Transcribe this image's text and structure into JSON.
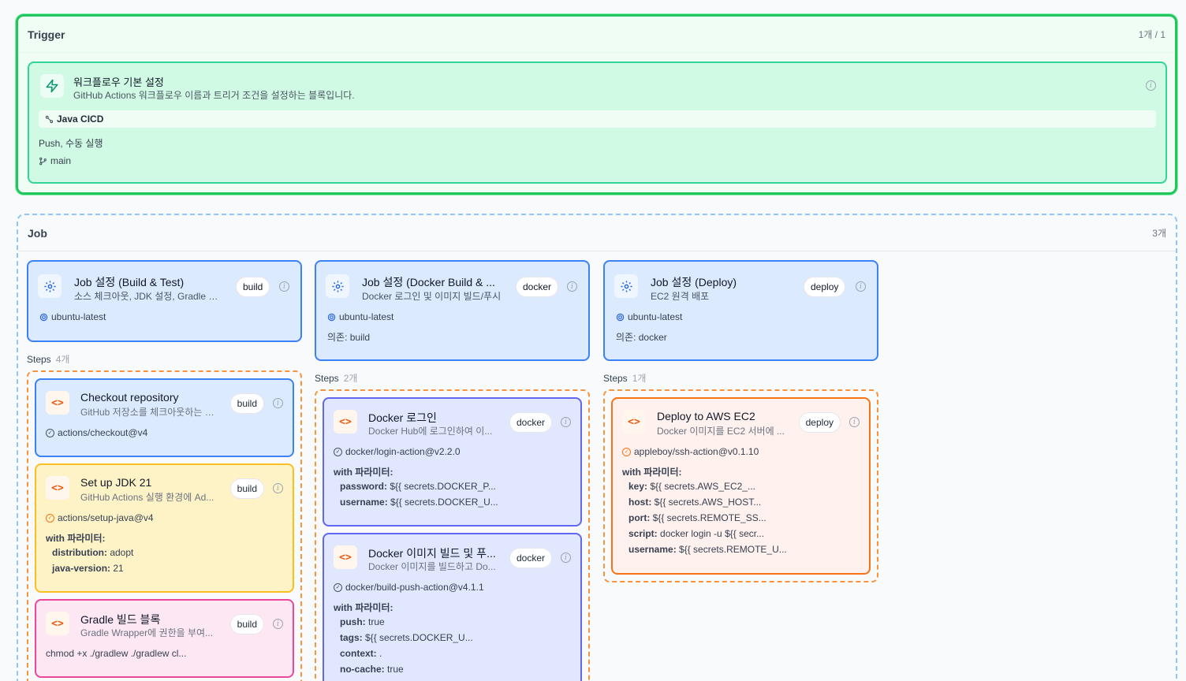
{
  "trigger": {
    "section_title": "Trigger",
    "count": "1개 / 1",
    "card": {
      "title": "워크플로우 기본 설정",
      "description": "GitHub Actions 워크플로우 이름과 트리거 조건을 설정하는 블록입니다.",
      "workflow_name": "Java CICD",
      "events": "Push, 수동 실행",
      "branch": "main"
    }
  },
  "job": {
    "section_title": "Job",
    "count": "3개",
    "jobs": [
      {
        "title": "Job 설정 (Build & Test)",
        "description": "소스 체크아웃, JDK 설정, Gradle 빌...",
        "badge": "build",
        "runs_on": "ubuntu-latest",
        "needs": "",
        "steps_label": "Steps",
        "steps_count": "4개",
        "steps": [
          {
            "title": "Checkout repository",
            "description": "GitHub 저장소를 체크아웃하는 단...",
            "badge": "build",
            "uses": "actions/checkout@v4",
            "with_label": "",
            "params": []
          },
          {
            "title": "Set up JDK 21",
            "description": "GitHub Actions 실행 환경에 Ad...",
            "badge": "build",
            "uses": "actions/setup-java@v4",
            "with_label": "with 파라미터:",
            "params": [
              {
                "key": "distribution:",
                "value": " adopt"
              },
              {
                "key": "java-version:",
                "value": " 21"
              }
            ]
          },
          {
            "title": "Gradle 빌드 블록",
            "description": "Gradle Wrapper에 권한을 부여...",
            "badge": "build",
            "run": "chmod +x ./gradlew ./gradlew cl..."
          }
        ]
      },
      {
        "title": "Job 설정 (Docker Build & ...",
        "description": "Docker 로그인 및 이미지 빌드/푸시",
        "badge": "docker",
        "runs_on": "ubuntu-latest",
        "needs": "의존: build",
        "steps_label": "Steps",
        "steps_count": "2개",
        "steps": [
          {
            "title": "Docker 로그인",
            "description": "Docker Hub에 로그인하여 이...",
            "badge": "docker",
            "uses": "docker/login-action@v2.2.0",
            "with_label": "with 파라미터:",
            "params": [
              {
                "key": "password:",
                "value": " ${{ secrets.DOCKER_P..."
              },
              {
                "key": "username:",
                "value": " ${{ secrets.DOCKER_U..."
              }
            ]
          },
          {
            "title": "Docker 이미지 빌드 및 푸...",
            "description": "Docker 이미지를 빌드하고 Do...",
            "badge": "docker",
            "uses": "docker/build-push-action@v4.1.1",
            "with_label": "with 파라미터:",
            "params": [
              {
                "key": "push:",
                "value": " true"
              },
              {
                "key": "tags:",
                "value": " ${{ secrets.DOCKER_U..."
              },
              {
                "key": "context:",
                "value": " ."
              },
              {
                "key": "no-cache:",
                "value": " true"
              }
            ]
          }
        ]
      },
      {
        "title": "Job 설정 (Deploy)",
        "description": "EC2 원격 배포",
        "badge": "deploy",
        "runs_on": "ubuntu-latest",
        "needs": "의존: docker",
        "steps_label": "Steps",
        "steps_count": "1개",
        "steps": [
          {
            "title": "Deploy to AWS EC2",
            "description": "Docker 이미지를 EC2 서버에 ...",
            "badge": "deploy",
            "uses": "appleboy/ssh-action@v0.1.10",
            "with_label": "with 파라미터:",
            "params": [
              {
                "key": "key:",
                "value": " ${{ secrets.AWS_EC2_..."
              },
              {
                "key": "host:",
                "value": " ${{ secrets.AWS_HOST..."
              },
              {
                "key": "port:",
                "value": " ${{ secrets.REMOTE_SS..."
              },
              {
                "key": "script:",
                "value": " docker login -u ${{ secr..."
              },
              {
                "key": "username:",
                "value": " ${{ secrets.REMOTE_U..."
              }
            ]
          }
        ]
      }
    ]
  },
  "icons": {
    "trigger": "lightning-icon",
    "job": "gear-icon",
    "step": "code-icon",
    "info": "info-icon",
    "workflow": "link-icon",
    "branch": "git-branch-icon",
    "uses": "check-circle-icon"
  },
  "colors": {
    "trigger_border": "#22c55e",
    "job_border": "#3b82f6",
    "steps_border": "#fb923c"
  }
}
